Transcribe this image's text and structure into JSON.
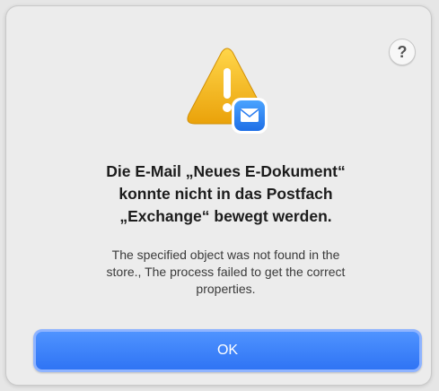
{
  "dialog": {
    "help_label": "?",
    "title_lines": [
      "Die E-Mail „Neues E-Dokument“",
      "konnte nicht in das Postfach",
      "„Exchange“ bewegt werden."
    ],
    "message_lines": [
      "The specified object was not found in the",
      "store., The process failed to get the correct",
      "properties."
    ],
    "ok_label": "OK",
    "icon": "warning-triangle-with-mail-badge",
    "colors": {
      "accent": "#3478f6",
      "warning": "#f2b20f",
      "mail_badge": "#2a7cf0"
    }
  }
}
